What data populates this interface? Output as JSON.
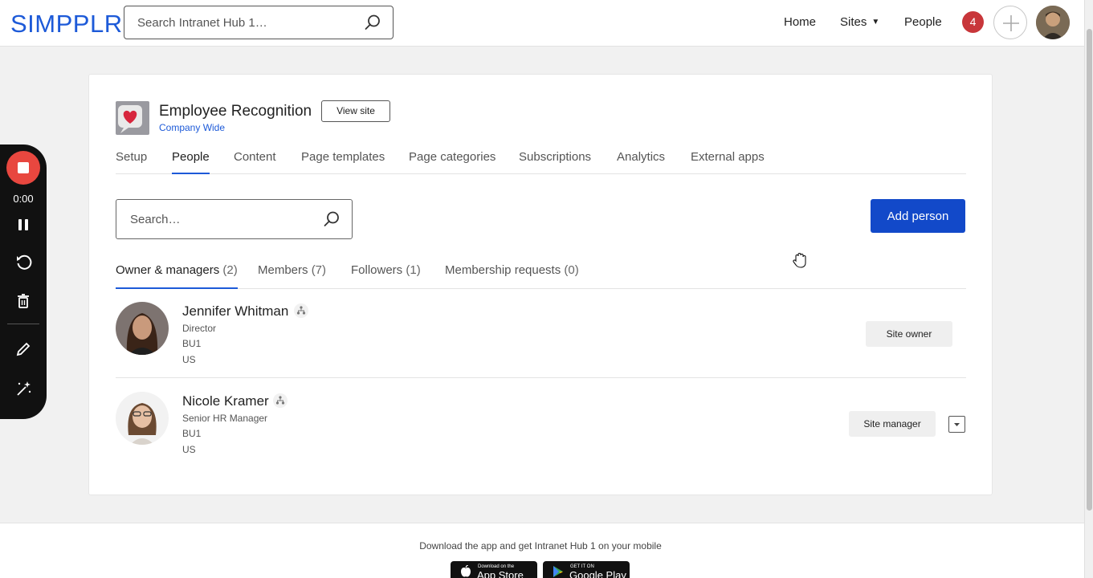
{
  "brand": {
    "logo_text": "SIMPPLR",
    "accent": "#1d5ad8"
  },
  "topnav": {
    "search_placeholder": "Search Intranet Hub 1…",
    "home": "Home",
    "sites": "Sites",
    "people": "People",
    "notification_count": "4"
  },
  "site": {
    "title": "Employee Recognition",
    "subtitle": "Company Wide",
    "view_site": "View site"
  },
  "tabs": [
    {
      "label": "Setup"
    },
    {
      "label": "People"
    },
    {
      "label": "Content"
    },
    {
      "label": "Page templates"
    },
    {
      "label": "Page categories"
    },
    {
      "label": "Subscriptions"
    },
    {
      "label": "Analytics"
    },
    {
      "label": "External apps"
    }
  ],
  "people_search": {
    "placeholder": "Search…"
  },
  "add_person": "Add person",
  "subtabs": [
    {
      "label": "Owner & managers",
      "count": "(2)"
    },
    {
      "label": "Members",
      "count": "(7)"
    },
    {
      "label": "Followers",
      "count": "(1)"
    },
    {
      "label": "Membership requests",
      "count": "(0)"
    }
  ],
  "members": [
    {
      "name": "Jennifer Whitman",
      "title": "Director",
      "unit": "BU1",
      "country": "US",
      "role": "Site owner"
    },
    {
      "name": "Nicole Kramer",
      "title": "Senior HR Manager",
      "unit": "BU1",
      "country": "US",
      "role": "Site manager"
    }
  ],
  "footer": {
    "text": "Download the app and get Intranet Hub 1 on your mobile",
    "app_store_small": "Download on the",
    "app_store": "App Store",
    "google_small": "GET IT ON",
    "google": "Google Play"
  },
  "recorder": {
    "time": "0:00"
  }
}
